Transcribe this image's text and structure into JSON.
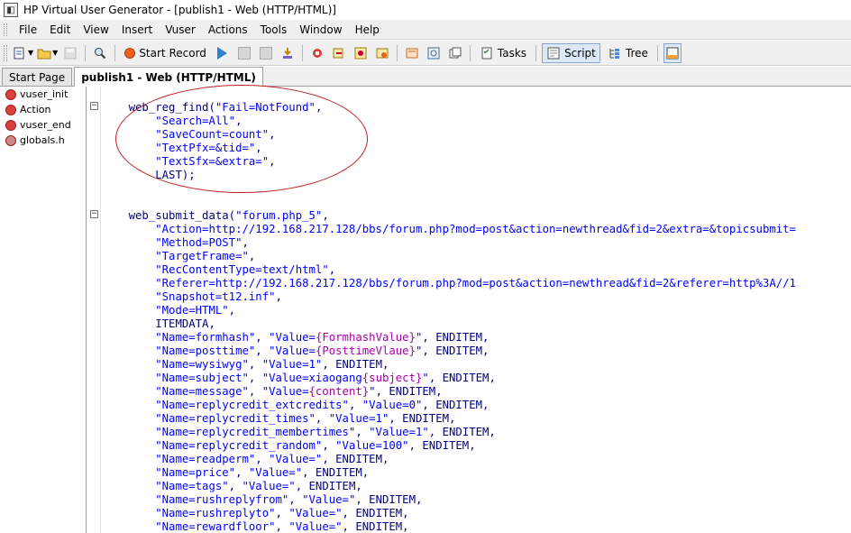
{
  "window": {
    "title": "HP Virtual User Generator - [publish1 - Web (HTTP/HTML)]"
  },
  "menu": [
    "File",
    "Edit",
    "View",
    "Insert",
    "Vuser",
    "Actions",
    "Tools",
    "Window",
    "Help"
  ],
  "toolbar": {
    "start_record": "Start Record",
    "tasks": "Tasks",
    "script": "Script",
    "tree": "Tree"
  },
  "tabs": [
    {
      "label": "Start Page",
      "active": false
    },
    {
      "label": "publish1 - Web (HTTP/HTML)",
      "active": true
    }
  ],
  "sidebar": [
    {
      "label": "vuser_init",
      "icon": "vuser-action-icon"
    },
    {
      "label": "Action",
      "icon": "vuser-action-icon"
    },
    {
      "label": "vuser_end",
      "icon": "vuser-action-icon"
    },
    {
      "label": "globals.h",
      "icon": "header-file-icon"
    }
  ],
  "code": [
    {
      "pre": "    ",
      "segs": [
        {
          "t": "web_reg_find(",
          "c": ""
        },
        {
          "t": "\"Fail=NotFound\"",
          "c": "str"
        },
        {
          "t": ",",
          "c": ""
        }
      ]
    },
    {
      "pre": "        ",
      "segs": [
        {
          "t": "\"Search=All\"",
          "c": "str"
        },
        {
          "t": ",",
          "c": ""
        }
      ]
    },
    {
      "pre": "        ",
      "segs": [
        {
          "t": "\"SaveCount=count\"",
          "c": "str"
        },
        {
          "t": ",",
          "c": ""
        }
      ]
    },
    {
      "pre": "        ",
      "segs": [
        {
          "t": "\"TextPfx=&tid=\"",
          "c": "str"
        },
        {
          "t": ",",
          "c": ""
        }
      ]
    },
    {
      "pre": "        ",
      "segs": [
        {
          "t": "\"TextSfx=&extra=\"",
          "c": "str"
        },
        {
          "t": ",",
          "c": ""
        }
      ]
    },
    {
      "pre": "        ",
      "segs": [
        {
          "t": "LAST);",
          "c": ""
        }
      ]
    },
    {
      "pre": "",
      "segs": []
    },
    {
      "pre": "",
      "segs": []
    },
    {
      "pre": "    ",
      "segs": [
        {
          "t": "web_submit_data(",
          "c": ""
        },
        {
          "t": "\"forum.php_5\"",
          "c": "str"
        },
        {
          "t": ",",
          "c": ""
        }
      ]
    },
    {
      "pre": "        ",
      "segs": [
        {
          "t": "\"Action=http://192.168.217.128/bbs/forum.php?mod=post&action=newthread&fid=2&extra=&topicsubmit=",
          "c": "str"
        }
      ]
    },
    {
      "pre": "        ",
      "segs": [
        {
          "t": "\"Method=POST\"",
          "c": "str"
        },
        {
          "t": ",",
          "c": ""
        }
      ]
    },
    {
      "pre": "        ",
      "segs": [
        {
          "t": "\"TargetFrame=\"",
          "c": "str"
        },
        {
          "t": ",",
          "c": ""
        }
      ]
    },
    {
      "pre": "        ",
      "segs": [
        {
          "t": "\"RecContentType=text/html\"",
          "c": "str"
        },
        {
          "t": ",",
          "c": ""
        }
      ]
    },
    {
      "pre": "        ",
      "segs": [
        {
          "t": "\"Referer=http://192.168.217.128/bbs/forum.php?mod=post&action=newthread&fid=2&referer=http%3A//1",
          "c": "str"
        }
      ]
    },
    {
      "pre": "        ",
      "segs": [
        {
          "t": "\"Snapshot=t12.inf\"",
          "c": "str"
        },
        {
          "t": ",",
          "c": ""
        }
      ]
    },
    {
      "pre": "        ",
      "segs": [
        {
          "t": "\"Mode=HTML\"",
          "c": "str"
        },
        {
          "t": ",",
          "c": ""
        }
      ]
    },
    {
      "pre": "        ",
      "segs": [
        {
          "t": "ITEMDATA,",
          "c": ""
        }
      ]
    },
    {
      "pre": "        ",
      "segs": [
        {
          "t": "\"Name=formhash\"",
          "c": "str"
        },
        {
          "t": ", ",
          "c": ""
        },
        {
          "t": "\"Value=",
          "c": "str"
        },
        {
          "t": "{FormhashValue}",
          "c": "pm"
        },
        {
          "t": "\"",
          "c": "str"
        },
        {
          "t": ", ENDITEM,",
          "c": ""
        }
      ]
    },
    {
      "pre": "        ",
      "segs": [
        {
          "t": "\"Name=posttime\"",
          "c": "str"
        },
        {
          "t": ", ",
          "c": ""
        },
        {
          "t": "\"Value=",
          "c": "str"
        },
        {
          "t": "{PosttimeVlaue}",
          "c": "pm"
        },
        {
          "t": "\"",
          "c": "str"
        },
        {
          "t": ", ENDITEM,",
          "c": ""
        }
      ]
    },
    {
      "pre": "        ",
      "segs": [
        {
          "t": "\"Name=wysiwyg\"",
          "c": "str"
        },
        {
          "t": ", ",
          "c": ""
        },
        {
          "t": "\"Value=1\"",
          "c": "str"
        },
        {
          "t": ", ENDITEM,",
          "c": ""
        }
      ]
    },
    {
      "pre": "        ",
      "segs": [
        {
          "t": "\"Name=subject\"",
          "c": "str"
        },
        {
          "t": ", ",
          "c": ""
        },
        {
          "t": "\"Value=xiaogang",
          "c": "str"
        },
        {
          "t": "{subject}",
          "c": "pm"
        },
        {
          "t": "\"",
          "c": "str"
        },
        {
          "t": ", ENDITEM,",
          "c": ""
        }
      ]
    },
    {
      "pre": "        ",
      "segs": [
        {
          "t": "\"Name=message\"",
          "c": "str"
        },
        {
          "t": ", ",
          "c": ""
        },
        {
          "t": "\"Value=",
          "c": "str"
        },
        {
          "t": "{content}",
          "c": "pm"
        },
        {
          "t": "\"",
          "c": "str"
        },
        {
          "t": ", ENDITEM,",
          "c": ""
        }
      ]
    },
    {
      "pre": "        ",
      "segs": [
        {
          "t": "\"Name=replycredit_extcredits\"",
          "c": "str"
        },
        {
          "t": ", ",
          "c": ""
        },
        {
          "t": "\"Value=0\"",
          "c": "str"
        },
        {
          "t": ", ENDITEM,",
          "c": ""
        }
      ]
    },
    {
      "pre": "        ",
      "segs": [
        {
          "t": "\"Name=replycredit_times\"",
          "c": "str"
        },
        {
          "t": ", ",
          "c": ""
        },
        {
          "t": "\"Value=1\"",
          "c": "str"
        },
        {
          "t": ", ENDITEM,",
          "c": ""
        }
      ]
    },
    {
      "pre": "        ",
      "segs": [
        {
          "t": "\"Name=replycredit_membertimes\"",
          "c": "str"
        },
        {
          "t": ", ",
          "c": ""
        },
        {
          "t": "\"Value=1\"",
          "c": "str"
        },
        {
          "t": ", ENDITEM,",
          "c": ""
        }
      ]
    },
    {
      "pre": "        ",
      "segs": [
        {
          "t": "\"Name=replycredit_random\"",
          "c": "str"
        },
        {
          "t": ", ",
          "c": ""
        },
        {
          "t": "\"Value=100\"",
          "c": "str"
        },
        {
          "t": ", ENDITEM,",
          "c": ""
        }
      ]
    },
    {
      "pre": "        ",
      "segs": [
        {
          "t": "\"Name=readperm\"",
          "c": "str"
        },
        {
          "t": ", ",
          "c": ""
        },
        {
          "t": "\"Value=\"",
          "c": "str"
        },
        {
          "t": ", ENDITEM,",
          "c": ""
        }
      ]
    },
    {
      "pre": "        ",
      "segs": [
        {
          "t": "\"Name=price\"",
          "c": "str"
        },
        {
          "t": ", ",
          "c": ""
        },
        {
          "t": "\"Value=\"",
          "c": "str"
        },
        {
          "t": ", ENDITEM,",
          "c": ""
        }
      ]
    },
    {
      "pre": "        ",
      "segs": [
        {
          "t": "\"Name=tags\"",
          "c": "str"
        },
        {
          "t": ", ",
          "c": ""
        },
        {
          "t": "\"Value=\"",
          "c": "str"
        },
        {
          "t": ", ENDITEM,",
          "c": ""
        }
      ]
    },
    {
      "pre": "        ",
      "segs": [
        {
          "t": "\"Name=rushreplyfrom\"",
          "c": "str"
        },
        {
          "t": ", ",
          "c": ""
        },
        {
          "t": "\"Value=\"",
          "c": "str"
        },
        {
          "t": ", ENDITEM,",
          "c": ""
        }
      ]
    },
    {
      "pre": "        ",
      "segs": [
        {
          "t": "\"Name=rushreplyto\"",
          "c": "str"
        },
        {
          "t": ", ",
          "c": ""
        },
        {
          "t": "\"Value=\"",
          "c": "str"
        },
        {
          "t": ", ENDITEM,",
          "c": ""
        }
      ]
    },
    {
      "pre": "        ",
      "segs": [
        {
          "t": "\"Name=rewardfloor\"",
          "c": "str"
        },
        {
          "t": ", ",
          "c": ""
        },
        {
          "t": "\"Value=\"",
          "c": "str"
        },
        {
          "t": ", ENDITEM,",
          "c": ""
        }
      ]
    }
  ],
  "colors": {
    "keyword": "#000080",
    "string": "#0000ff",
    "param": "#aa00aa",
    "annotation": "#c02020"
  }
}
